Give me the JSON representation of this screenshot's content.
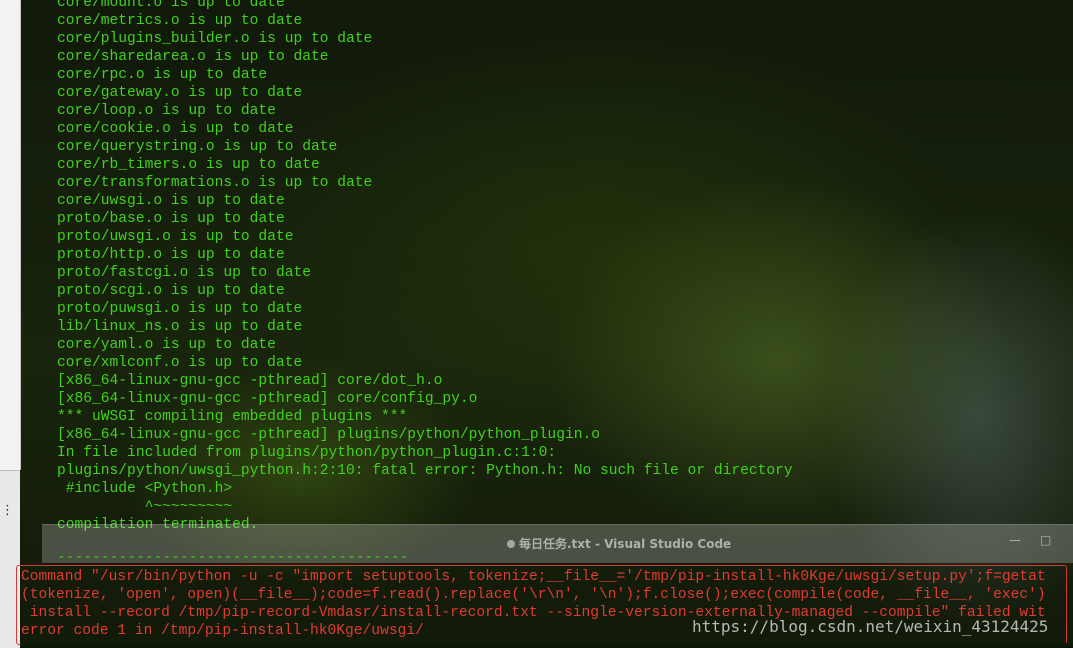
{
  "terminal": {
    "lines": [
      "core/mount.o is up to date",
      "core/metrics.o is up to date",
      "core/plugins_builder.o is up to date",
      "core/sharedarea.o is up to date",
      "core/rpc.o is up to date",
      "core/gateway.o is up to date",
      "core/loop.o is up to date",
      "core/cookie.o is up to date",
      "core/querystring.o is up to date",
      "core/rb_timers.o is up to date",
      "core/transformations.o is up to date",
      "core/uwsgi.o is up to date",
      "proto/base.o is up to date",
      "proto/uwsgi.o is up to date",
      "proto/http.o is up to date",
      "proto/fastcgi.o is up to date",
      "proto/scgi.o is up to date",
      "proto/puwsgi.o is up to date",
      "lib/linux_ns.o is up to date",
      "core/yaml.o is up to date",
      "core/xmlconf.o is up to date",
      "[x86_64-linux-gnu-gcc -pthread] core/dot_h.o",
      "[x86_64-linux-gnu-gcc -pthread] core/config_py.o",
      "*** uWSGI compiling embedded plugins ***",
      "[x86_64-linux-gnu-gcc -pthread] plugins/python/python_plugin.o",
      "In file included from plugins/python/python_plugin.c:1:0:",
      "plugins/python/uwsgi_python.h:2:10: fatal error: Python.h: No such file or directory",
      " #include <Python.h>",
      "          ^~~~~~~~~~",
      "compilation terminated."
    ],
    "separator": "----------------------------------------",
    "error_lines": [
      "Command \"/usr/bin/python -u -c \"import setuptools, tokenize;__file__='/tmp/pip-install-hk0Kge/uwsgi/setup.py';f=getat",
      "(tokenize, 'open', open)(__file__);code=f.read().replace('\\r\\n', '\\n');f.close();exec(compile(code, __file__, 'exec')",
      " install --record /tmp/pip-record-Vmdasr/install-record.txt --single-version-externally-managed --compile\" failed wit",
      "error code 1 in /tmp/pip-install-hk0Kge/uwsgi/"
    ]
  },
  "background_window": {
    "title": "每日任务.txt - Visual Studio Code",
    "minimize_label": "—",
    "maximize_label": "□"
  },
  "left_panel": {
    "menu_glyph": "⋮"
  },
  "watermark": "https://blog.csdn.net/weixin_43124425",
  "colors": {
    "terminal_text": "#42d11f",
    "error_text": "#e03b30",
    "error_border": "#d63a3a"
  }
}
